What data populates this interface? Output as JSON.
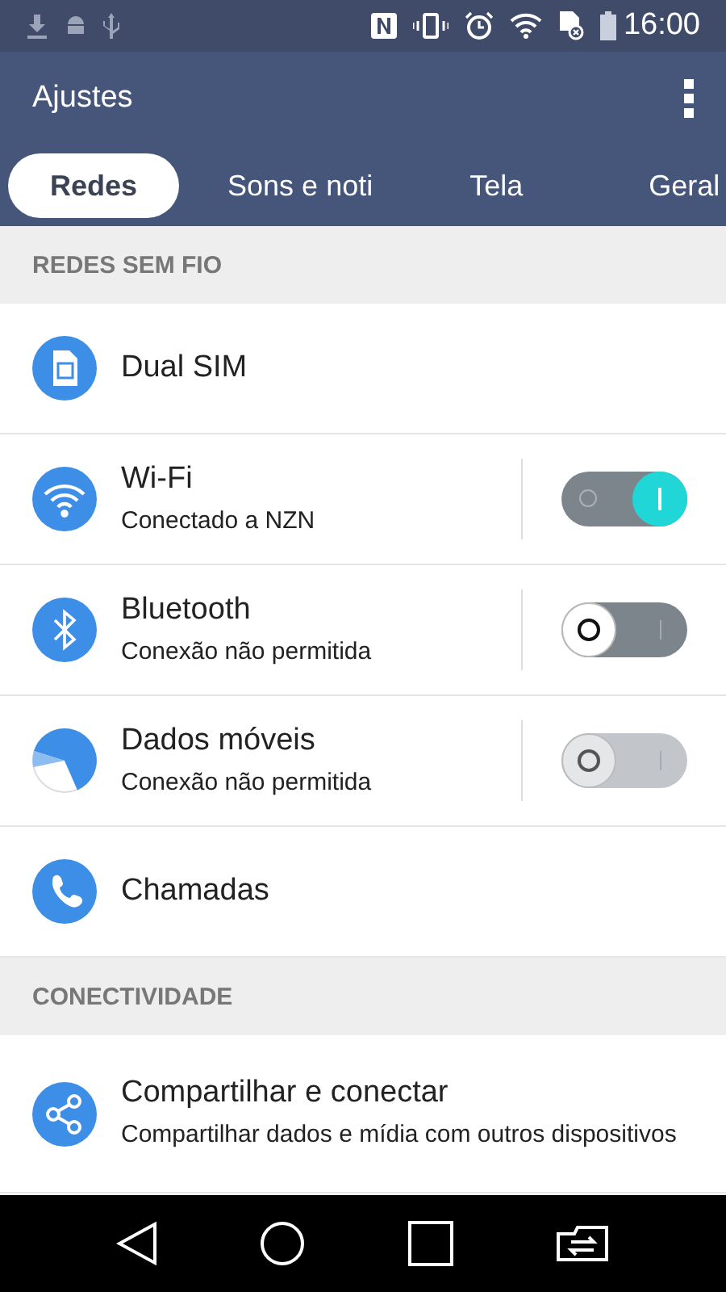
{
  "status_bar": {
    "time": "16:00"
  },
  "app_bar": {
    "title": "Ajustes"
  },
  "tabs": [
    {
      "label": "Redes",
      "selected": true
    },
    {
      "label": "Sons e noti",
      "selected": false
    },
    {
      "label": "Tela",
      "selected": false
    },
    {
      "label": "Geral",
      "selected": false
    }
  ],
  "sections": [
    {
      "header": "REDES SEM FIO",
      "items": [
        {
          "kind": "plain",
          "title": "Dual SIM"
        },
        {
          "kind": "toggle",
          "title": "Wi-Fi",
          "subtitle": "Conectado a NZN",
          "on": true,
          "disabled": false
        },
        {
          "kind": "toggle",
          "title": "Bluetooth",
          "subtitle": "Conexão não permitida",
          "on": false,
          "disabled": false
        },
        {
          "kind": "toggle",
          "title": "Dados móveis",
          "subtitle": "Conexão não permitida",
          "on": false,
          "disabled": true
        },
        {
          "kind": "plain",
          "title": "Chamadas"
        }
      ]
    },
    {
      "header": "CONECTIVIDADE",
      "items": [
        {
          "kind": "plain",
          "title": "Compartilhar e conectar",
          "subtitle": "Compartilhar dados e mídia com outros dispositivos"
        }
      ]
    }
  ]
}
